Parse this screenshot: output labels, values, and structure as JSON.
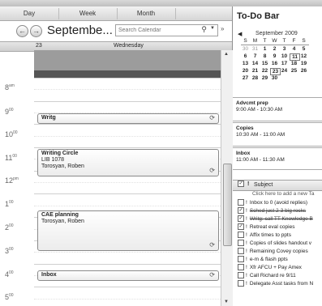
{
  "calendar": {
    "view_tabs": [
      "Day",
      "Week",
      "Month"
    ],
    "month_title": "Septembe...",
    "search_placeholder": "Search Calendar",
    "date_number": "23",
    "weekday": "Wednesday",
    "times": [
      {
        "h": "8",
        "m": "am"
      },
      {
        "h": "9",
        "m": "00"
      },
      {
        "h": "10",
        "m": "00"
      },
      {
        "h": "11",
        "m": "00"
      },
      {
        "h": "12",
        "m": "pm"
      },
      {
        "h": "1",
        "m": "00"
      },
      {
        "h": "2",
        "m": "00"
      },
      {
        "h": "3",
        "m": "00"
      },
      {
        "h": "4",
        "m": "00"
      },
      {
        "h": "5",
        "m": "00"
      }
    ],
    "appointments": [
      {
        "title": "Writg",
        "line2": "",
        "line3": ""
      },
      {
        "title": "Writing Circle",
        "line2": "LIB 1078",
        "line3": "Torosyan, Roben"
      },
      {
        "title": "CAE planning",
        "line2": "Torosyan, Roben",
        "line3": ""
      },
      {
        "title": "Inbox",
        "line2": "",
        "line3": ""
      }
    ]
  },
  "todo": {
    "title": "To-Do Bar",
    "mini_month": "September 2009",
    "weekdays": [
      "S",
      "M",
      "T",
      "W",
      "T",
      "F",
      "S"
    ],
    "weeks": [
      [
        "30",
        "31",
        "1",
        "2",
        "3",
        "4",
        "5"
      ],
      [
        "6",
        "7",
        "8",
        "9",
        "10",
        "11",
        "12"
      ],
      [
        "13",
        "14",
        "15",
        "16",
        "17",
        "18",
        "19"
      ],
      [
        "20",
        "21",
        "22",
        "23",
        "24",
        "25",
        "26"
      ],
      [
        "27",
        "28",
        "29",
        "30",
        "",
        "",
        ""
      ]
    ],
    "appointments": [
      {
        "title": "Advcmt prep",
        "time": "9:00 AM - 10:30 AM"
      },
      {
        "title": "Copies",
        "time": "10:30 AM - 11:00 AM"
      },
      {
        "title": "Inbox",
        "time": "11:00 AM - 11:30 AM"
      }
    ],
    "task_header": "Subject",
    "new_task_placeholder": "Click here to add a new Ta",
    "tasks": [
      {
        "text": "Inbox to 0 (avoid replies)",
        "checked": false,
        "done": false
      },
      {
        "text": "Sched just 2-3 big rocks",
        "checked": true,
        "done": true
      },
      {
        "text": "Writg: call TT Knowledge B",
        "checked": true,
        "done": true
      },
      {
        "text": "Retreat eval copies",
        "checked": true,
        "done": false
      },
      {
        "text": "Affix times to ppts",
        "checked": false,
        "done": false
      },
      {
        "text": "Copies of slides handout v",
        "checked": false,
        "done": false
      },
      {
        "text": "Remaining Covey copies",
        "checked": false,
        "done": false
      },
      {
        "text": "e-m & flash ppts",
        "checked": false,
        "done": false
      },
      {
        "text": "Xfr AFCU + Pay Amex",
        "checked": false,
        "done": false
      },
      {
        "text": "Call Richard re 9/11",
        "checked": false,
        "done": false
      },
      {
        "text": "Delegate Asst tasks from N",
        "checked": false,
        "done": false
      }
    ]
  }
}
